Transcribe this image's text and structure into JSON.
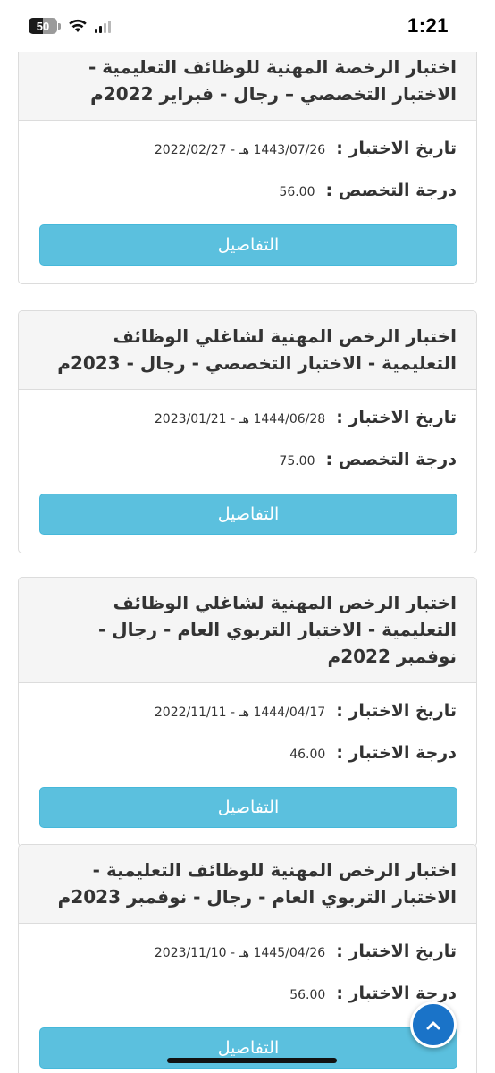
{
  "status_bar": {
    "time": "1:21",
    "battery_level": "50",
    "icons": [
      "wifi-icon",
      "cellular-signal-icon"
    ]
  },
  "colors": {
    "button": "#5bc0de",
    "card_header_bg": "#f5f5f5",
    "text": "#333333",
    "scroll_top": "#1a73c8"
  },
  "cards": [
    {
      "title": "اختبار الرخصة المهنية للوظائف التعليمية - الاختبار التخصصي – رجال - فبراير 2022م",
      "date_label": "تاريخ الاختبار :",
      "date_value": "1443/07/26 هـ - 2022/02/27",
      "score_label": "درجة التخصص :",
      "score_value": "56.00",
      "button_label": "التفاصيل"
    },
    {
      "title": "اختبار الرخص المهنية لشاغلي الوظائف التعليمية - الاختبار التخصصي - رجال - 2023م",
      "date_label": "تاريخ الاختبار :",
      "date_value": "1444/06/28 هـ - 2023/01/21",
      "score_label": "درجة التخصص :",
      "score_value": "75.00",
      "button_label": "التفاصيل"
    },
    {
      "title": "اختبار الرخص المهنية لشاغلي الوظائف التعليمية - الاختبار التربوي العام - رجال - نوفمبر 2022م",
      "date_label": "تاريخ الاختبار :",
      "date_value": "1444/04/17 هـ - 2022/11/11",
      "score_label": "درجة الاختبار :",
      "score_value": "46.00",
      "button_label": "التفاصيل"
    },
    {
      "title": "اختبار الرخص المهنية للوظائف التعليمية - الاختبار التربوي العام - رجال - نوفمبر 2023م",
      "date_label": "تاريخ الاختبار :",
      "date_value": "1445/04/26 هـ - 2023/11/10",
      "score_label": "درجة الاختبار :",
      "score_value": "56.00",
      "button_label": "التفاصيل"
    }
  ]
}
